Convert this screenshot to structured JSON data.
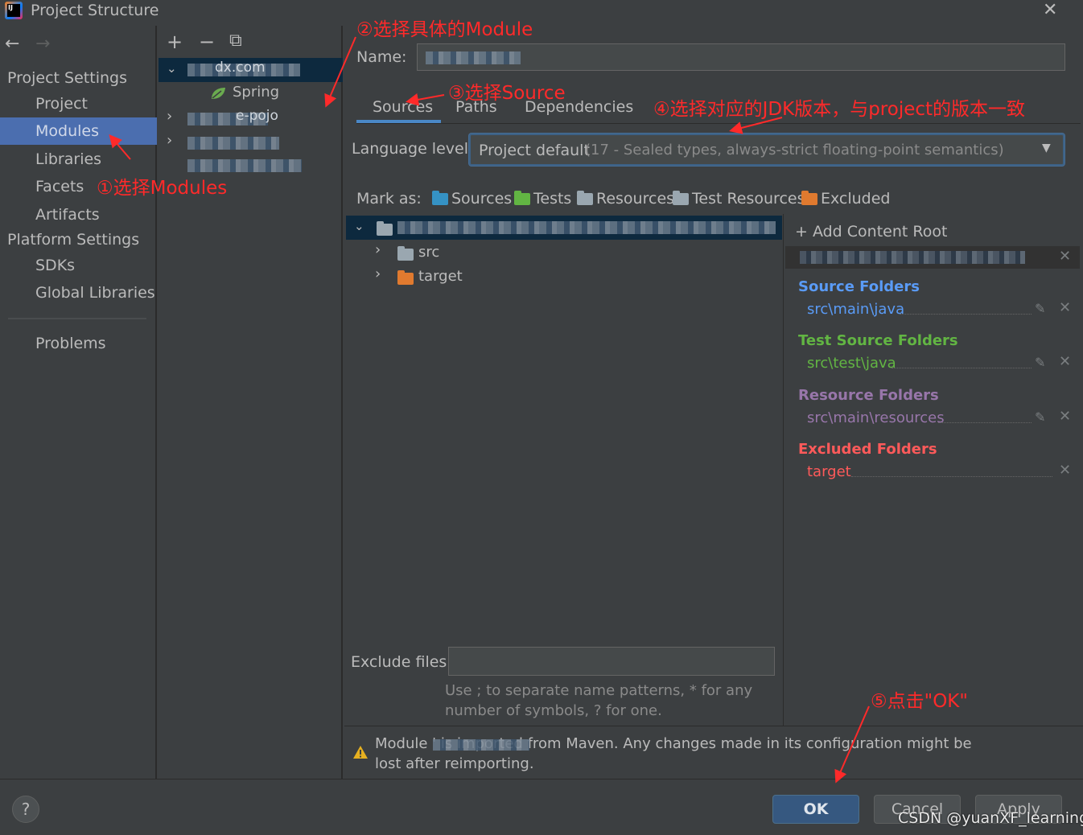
{
  "window": {
    "title": "Project Structure",
    "close_label": "✕"
  },
  "nav": {
    "back": "←",
    "forward": "→",
    "project_settings_header": "Project Settings",
    "items_project": [
      "Project",
      "Modules",
      "Libraries",
      "Facets",
      "Artifacts"
    ],
    "platform_settings_header": "Platform Settings",
    "items_platform": [
      "SDKs",
      "Global Libraries"
    ],
    "problems": "Problems",
    "selected": "Modules"
  },
  "tree": {
    "toolbar": {
      "add": "+",
      "remove": "−",
      "copy": "⧉"
    },
    "spring_label": "Spring",
    "partial_text_1": "dx.com",
    "partial_text_2": "e-pojo"
  },
  "module": {
    "name_label": "Name:",
    "tabs": [
      "Sources",
      "Paths",
      "Dependencies"
    ],
    "active_tab": "Sources",
    "language_level_label": "Language level:",
    "language_level_value": "Project default",
    "language_level_detail": "(17 - Sealed types, always-strict floating-point semantics)",
    "mark_as_label": "Mark as:",
    "mark_as": [
      {
        "label": "Sources",
        "color": "#3592c4"
      },
      {
        "label": "Tests",
        "color": "#62b543"
      },
      {
        "label": "Resources",
        "color": "#9aa7b0"
      },
      {
        "label": "Test Resources",
        "color": "#9aa7b0"
      },
      {
        "label": "Excluded",
        "color": "#e07a2f"
      }
    ],
    "folders": [
      {
        "name": "src",
        "color": "#9aa7b0"
      },
      {
        "name": "target",
        "color": "#e07a2f"
      }
    ],
    "exclude_files_label": "Exclude files:",
    "exclude_hint_line1": "Use ; to separate name patterns, * for any",
    "exclude_hint_line2": "number of symbols, ? for one.",
    "warning_line1": "Module            ' is imported from Maven. Any changes made in its configuration might be",
    "warning_line2": "lost after reimporting."
  },
  "content_root": {
    "add_label": "+ Add Content Root",
    "sections": [
      {
        "title": "Source Folders",
        "value": "src\\main\\java",
        "color": "#5a9bf6",
        "value_color": "#5a9bf6"
      },
      {
        "title": "Test Source Folders",
        "value": "src\\test\\java",
        "color": "#62b543",
        "value_color": "#62b543"
      },
      {
        "title": "Resource Folders",
        "value": "src\\main\\resources",
        "color": "#9876aa",
        "value_color": "#9876aa"
      },
      {
        "title": "Excluded Folders",
        "value": "target",
        "color": "#ff5a5a",
        "value_color": "#ff5a5a"
      }
    ]
  },
  "buttons": {
    "help": "?",
    "ok": "OK",
    "cancel": "Cancel",
    "apply": "Apply"
  },
  "annotations": {
    "a1": "①选择Modules",
    "a2": "②选择具体的Module",
    "a3": "③选择Source",
    "a4": "④选择对应的JDK版本，与project的版本一致",
    "a5": "⑤点击\"OK\""
  },
  "watermark": "CSDN @yuanXF_learning"
}
